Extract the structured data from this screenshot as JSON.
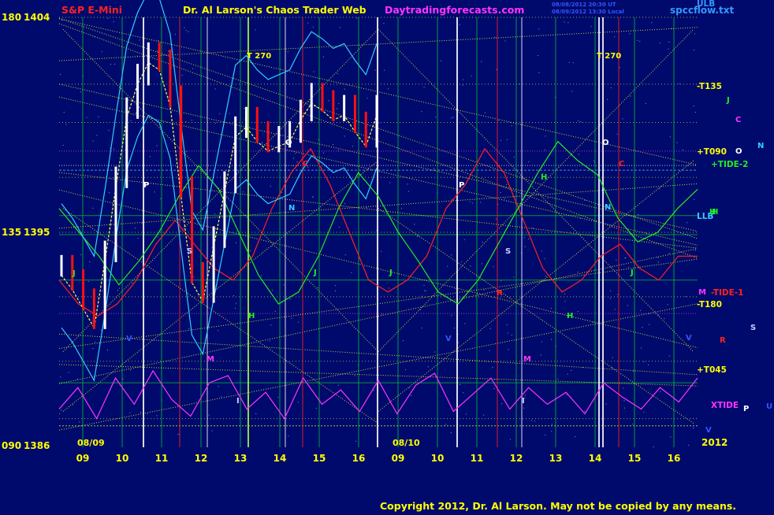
{
  "header": {
    "market": "S&P E-Mini",
    "site_title": "Dr. Al Larson's Chaos Trader Web",
    "site_url": "Daytradingforecasts.com",
    "timestamp_1": "08/08/2012 20:30 UT",
    "timestamp_2": "08/09/2012 13:30 Local",
    "file_name": "spccflow.txt"
  },
  "footer": {
    "copyright": "Copyright 2012, Dr. Al Larson. May not be copied by any means."
  },
  "colors": {
    "background": "#000a6c",
    "grid": "#00cc33",
    "price_up": "#ffffff",
    "price_down": "#ff1010",
    "ma_band": "#33ccff",
    "ma_mid": "#ffff55",
    "tide_red": "#ff2020",
    "tide_green": "#22ee22",
    "xtide": "#ff33ff",
    "diagonals": "#ffff33",
    "label_yellow": "#ffff00"
  },
  "chart_data": {
    "type": "line",
    "title": "S&P E-Mini",
    "y_axis_labels": [
      {
        "angle": "180",
        "price": "1404"
      },
      {
        "angle": "135",
        "price": "1395"
      },
      {
        "angle": "090",
        "price": "1386"
      }
    ],
    "ylim": [
      1386,
      1404
    ],
    "x_day_labels": [
      {
        "date": "08/09",
        "hours": [
          "09",
          "10",
          "11",
          "12",
          "13",
          "14",
          "15",
          "16"
        ]
      },
      {
        "date": "08/10",
        "hours": [
          "09",
          "10",
          "11",
          "12",
          "13",
          "14",
          "15",
          "16"
        ]
      }
    ],
    "year_label": "2012",
    "right_labels": [
      "ULB",
      "-T135",
      "+T090",
      "+TIDE-2",
      "LLB",
      "-TIDE-1",
      "-T180",
      "+T045",
      "XTIDE"
    ],
    "planet_markers_right": [
      "J",
      "C",
      "O",
      "N",
      "H",
      "M",
      "S",
      "R",
      "P",
      "U",
      "V"
    ],
    "inplot_markers": [
      "T 270",
      "T 270",
      "P",
      "P",
      "S",
      "S",
      "O",
      "O",
      "C",
      "C",
      "N",
      "N",
      "J",
      "J",
      "J",
      "J",
      "H",
      "H",
      "H",
      "H",
      "R",
      "M",
      "M",
      "V",
      "V",
      "V",
      "I",
      "I"
    ],
    "series": [
      {
        "name": "price",
        "values": [
          1393.6,
          1393.0,
          1392.2,
          1391.4,
          1394.2,
          1397.3,
          1400.2,
          1401.6,
          1402.5,
          1402.2,
          1400.7,
          1396.9,
          1393.3,
          1392.5,
          1394.8,
          1397.1,
          1399.4,
          1399.8,
          1399.2,
          1398.8,
          1399.0,
          1399.2,
          1400.1,
          1400.8,
          1400.5,
          1400.1,
          1400.3,
          1399.6,
          1399.0,
          1400.3
        ]
      },
      {
        "name": "TIDE-1",
        "values": [
          1393,
          1392,
          1391.5,
          1392,
          1393,
          1394.5,
          1395.5,
          1394.5,
          1393.5,
          1393,
          1394,
          1396,
          1397.5,
          1398.5,
          1397,
          1395,
          1393,
          1392.5,
          1393,
          1394,
          1396,
          1397,
          1398.5,
          1397.5,
          1395.5,
          1393.5,
          1392.5,
          1393,
          1394,
          1394.5,
          1393.5,
          1393,
          1394,
          1394
        ]
      },
      {
        "name": "TIDE-2",
        "values": [
          1396,
          1395,
          1394,
          1392.8,
          1393.8,
          1395,
          1396.5,
          1397.8,
          1396.8,
          1395,
          1393.2,
          1392,
          1392.5,
          1394,
          1396,
          1397.5,
          1396.5,
          1395,
          1393.8,
          1392.5,
          1392,
          1393,
          1394.5,
          1396,
          1397.5,
          1398.8,
          1398,
          1397.4,
          1395.6,
          1394.6,
          1395,
          1396,
          1396.8
        ]
      },
      {
        "name": "XTIDE",
        "values": [
          1387.6,
          1388.5,
          1387.2,
          1388.9,
          1387.8,
          1389.2,
          1388.0,
          1387.3,
          1388.7,
          1389.0,
          1387.6,
          1388.3,
          1387.2,
          1388.9,
          1387.8,
          1388.4,
          1387.5,
          1388.8,
          1387.4,
          1388.6,
          1389.1,
          1387.5,
          1388.2,
          1388.9,
          1387.6,
          1388.5,
          1387.8,
          1388.3,
          1387.4,
          1388.7,
          1388.1,
          1387.6,
          1388.5,
          1387.9,
          1388.9
        ]
      }
    ]
  }
}
